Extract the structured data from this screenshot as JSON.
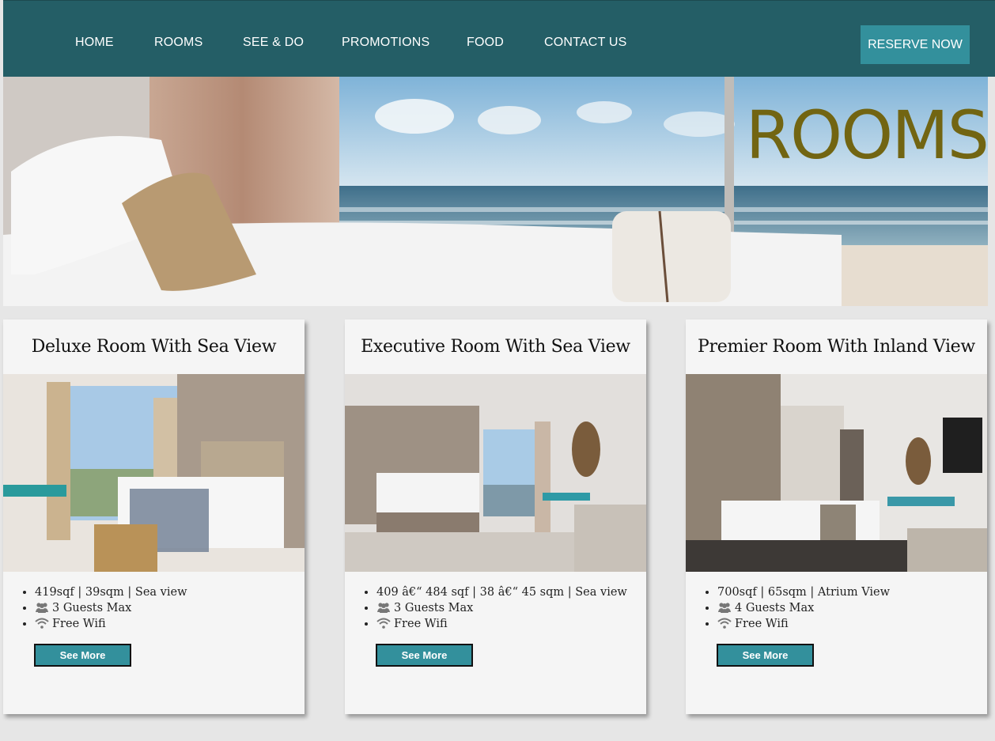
{
  "nav": {
    "links": [
      "HOME",
      "ROOMS",
      "SEE & DO",
      "PROMOTIONS",
      "FOOD",
      "CONTACT US"
    ],
    "reserve_label": "RESERVE NOW"
  },
  "hero": {
    "title": "ROOMS"
  },
  "rooms": [
    {
      "title": "Deluxe Room With Sea View",
      "size": "419sqf | 39sqm | Sea view",
      "guests": "3 Guests Max",
      "wifi": "Free Wifi",
      "button": "See More"
    },
    {
      "title": "Executive Room With Sea View",
      "size": "409 â€“ 484 sqf | 38 â€“ 45 sqm | Sea view",
      "guests": "3 Guests Max",
      "wifi": "Free Wifi",
      "button": "See More"
    },
    {
      "title": "Premier Room With Inland View",
      "size": "700sqf | 65sqm | Atrium View",
      "guests": "4 Guests Max",
      "wifi": "Free Wifi",
      "button": "See More"
    }
  ],
  "colors": {
    "nav_bg": "#245e66",
    "accent": "#33909c",
    "hero_title": "#726512",
    "page_bg": "#e6e6e6"
  },
  "icons": [
    "users-icon",
    "wifi-icon"
  ]
}
